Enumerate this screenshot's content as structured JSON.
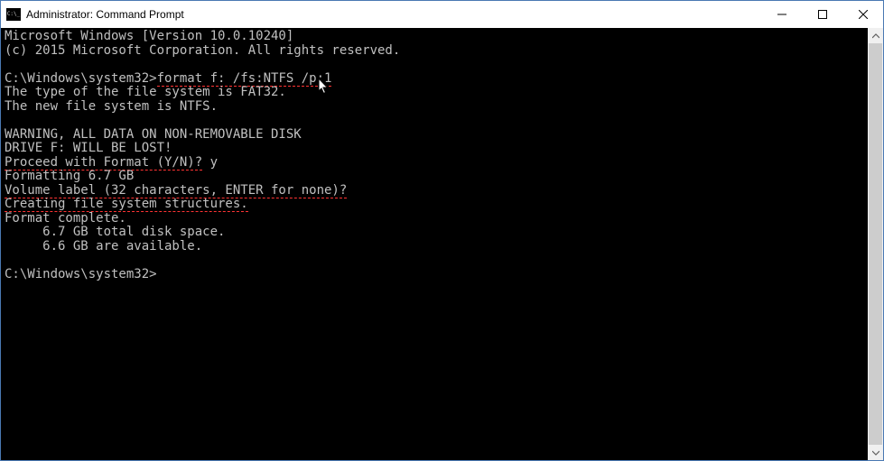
{
  "window": {
    "title": "Administrator: Command Prompt"
  },
  "terminal": {
    "line1": "Microsoft Windows [Version 10.0.10240]",
    "line2": "(c) 2015 Microsoft Corporation. All rights reserved.",
    "prompt1_path": "C:\\Windows\\system32>",
    "prompt1_cmd": "format f: /fs:NTFS /p:1",
    "fs_type": "The type of the file system is FAT32.",
    "new_type": "The new file system is NTFS.",
    "warn1": "WARNING, ALL DATA ON NON-REMOVABLE DISK",
    "warn2": "DRIVE F: WILL BE LOST!",
    "proceed_prompt": "Proceed with Format (Y/N)?",
    "proceed_ans": " y",
    "formatting": "Formatting 6.7 GB",
    "volume_label": "Volume label (32 characters, ENTER for none)?",
    "creating": "Creating file system structures.",
    "complete": "Format complete.",
    "total": "     6.7 GB total disk space.",
    "avail": "     6.6 GB are available.",
    "prompt2_path": "C:\\Windows\\system32>"
  }
}
